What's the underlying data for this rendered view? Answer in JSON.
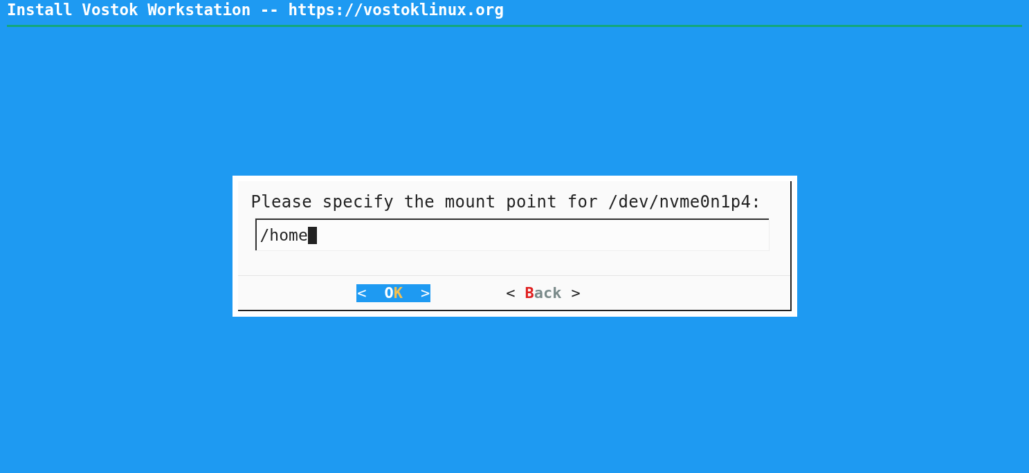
{
  "title": "Install Vostok Workstation -- https://vostoklinux.org",
  "dialog": {
    "prompt": "Please specify the mount point for /dev/nvme0n1p4:",
    "field": {
      "value": "/home",
      "focused": true
    },
    "buttons": [
      {
        "open": "<",
        "before": "O",
        "hotkey": "K",
        "close": ">",
        "selected": true
      },
      {
        "open": "<",
        "hotkey": "B",
        "after": "ack",
        "close": ">",
        "selected": false
      }
    ]
  }
}
